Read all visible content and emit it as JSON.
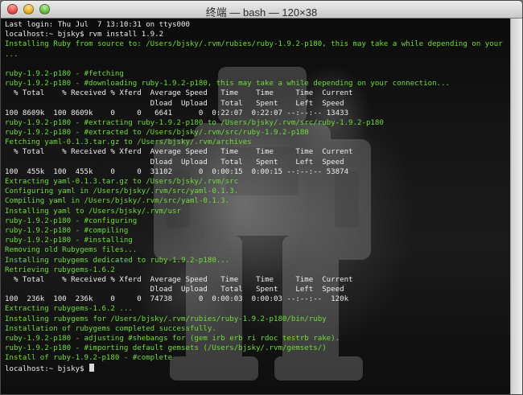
{
  "window": {
    "title": "终端 — bash — 120×38"
  },
  "terminal": {
    "lines": [
      {
        "text": "Last login: Thu Jul  7 13:10:31 on ttys000",
        "color": "white"
      },
      {
        "text": "localhost:~ bjsky$ rvm install 1.9.2",
        "color": "white"
      },
      {
        "text": "Installing Ruby from source to: /Users/bjsky/.rvm/rubies/ruby-1.9.2-p180, this may take a while depending on your cpu(s)",
        "color": "green"
      },
      {
        "text": "...",
        "color": "green"
      },
      {
        "text": "",
        "color": "white"
      },
      {
        "text": "ruby-1.9.2-p180 - #fetching",
        "color": "green"
      },
      {
        "text": "ruby-1.9.2-p180 - #downloading ruby-1.9.2-p180, this may take a while depending on your connection...",
        "color": "green"
      },
      {
        "text": "  % Total    % Received % Xferd  Average Speed   Time    Time     Time  Current",
        "color": "white"
      },
      {
        "text": "                                 Dload  Upload   Total   Spent    Left  Speed",
        "color": "white"
      },
      {
        "text": "100 8609k  100 8609k    0     0   6641      0  0:22:07  0:22:07 --:--:-- 13433",
        "color": "white"
      },
      {
        "text": "ruby-1.9.2-p180 - #extracting ruby-1.9.2-p180 to /Users/bjsky/.rvm/src/ruby-1.9.2-p180",
        "color": "green"
      },
      {
        "text": "ruby-1.9.2-p180 - #extracted to /Users/bjsky/.rvm/src/ruby-1.9.2-p180",
        "color": "green"
      },
      {
        "text": "Fetching yaml-0.1.3.tar.gz to /Users/bjsky/.rvm/archives",
        "color": "green"
      },
      {
        "text": "  % Total    % Received % Xferd  Average Speed   Time    Time     Time  Current",
        "color": "white"
      },
      {
        "text": "                                 Dload  Upload   Total   Spent    Left  Speed",
        "color": "white"
      },
      {
        "text": "100  455k  100  455k    0     0  31102      0  0:00:15  0:00:15 --:--:-- 53874",
        "color": "white"
      },
      {
        "text": "Extracting yaml-0.1.3.tar.gz to /Users/bjsky/.rvm/src",
        "color": "green"
      },
      {
        "text": "Configuring yaml in /Users/bjsky/.rvm/src/yaml-0.1.3.",
        "color": "green"
      },
      {
        "text": "Compiling yaml in /Users/bjsky/.rvm/src/yaml-0.1.3.",
        "color": "green"
      },
      {
        "text": "Installing yaml to /Users/bjsky/.rvm/usr",
        "color": "green"
      },
      {
        "text": "ruby-1.9.2-p180 - #configuring",
        "color": "green"
      },
      {
        "text": "ruby-1.9.2-p180 - #compiling",
        "color": "green"
      },
      {
        "text": "ruby-1.9.2-p180 - #installing",
        "color": "green"
      },
      {
        "text": "Removing old Rubygems files...",
        "color": "green"
      },
      {
        "text": "Installing rubygems dedicated to ruby-1.9.2-p180...",
        "color": "green"
      },
      {
        "text": "Retrieving rubygems-1.6.2",
        "color": "green"
      },
      {
        "text": "  % Total    % Received % Xferd  Average Speed   Time    Time     Time  Current",
        "color": "white"
      },
      {
        "text": "                                 Dload  Upload   Total   Spent    Left  Speed",
        "color": "white"
      },
      {
        "text": "100  236k  100  236k    0     0  74738      0  0:00:03  0:00:03 --:--:--  120k",
        "color": "white"
      },
      {
        "text": "Extracting rubygems-1.6.2 ...",
        "color": "green"
      },
      {
        "text": "Installing rubygems for /Users/bjsky/.rvm/rubies/ruby-1.9.2-p180/bin/ruby",
        "color": "green"
      },
      {
        "text": "Installation of rubygems completed successfully.",
        "color": "green"
      },
      {
        "text": "ruby-1.9.2-p180 - adjusting #shebangs for (gem irb erb ri rdoc testrb rake).",
        "color": "green"
      },
      {
        "text": "ruby-1.9.2-p180 - #importing default gemsets (/Users/bjsky/.rvm/gemsets/)",
        "color": "green"
      },
      {
        "text": "Install of ruby-1.9.2-p180 - #complete",
        "color": "green"
      }
    ],
    "prompt": "localhost:~ bjsky$ "
  },
  "colors": {
    "output_green": "#6fdc3a",
    "text_white": "#eeeeee",
    "background": "#000000"
  }
}
